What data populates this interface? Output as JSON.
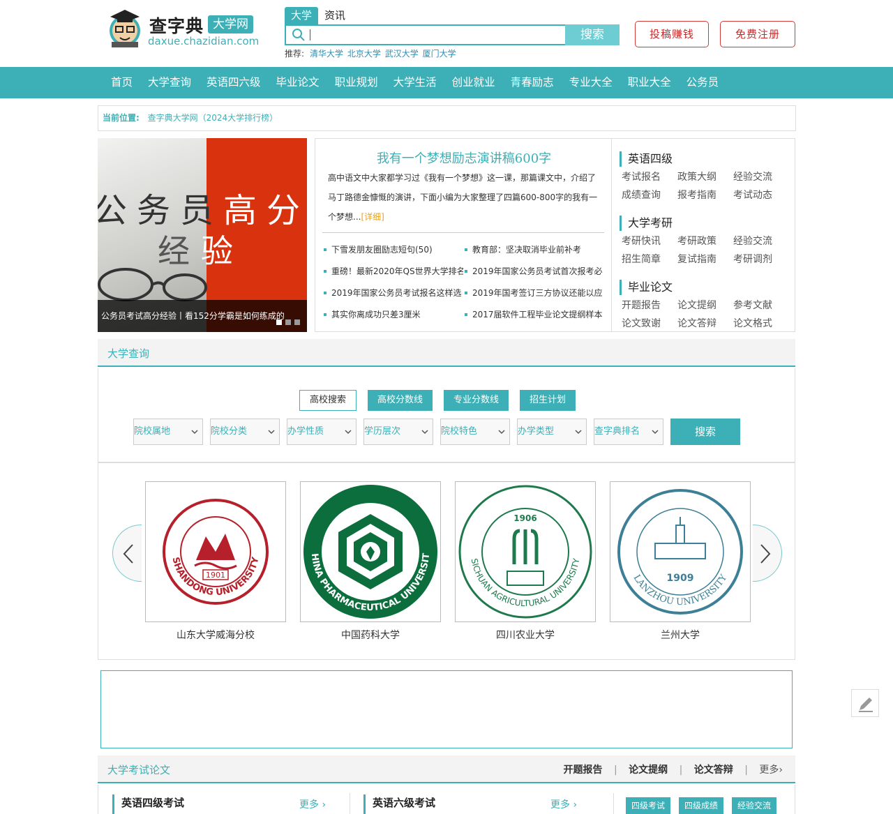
{
  "header": {
    "logo_name": "查字典",
    "logo_tag": "大学网",
    "logo_domain": "daxue.chazidian.com",
    "search_tabs": [
      "大学",
      "资讯"
    ],
    "search_placeholder": "",
    "search_button": "搜索",
    "recommend_label": "推荐:",
    "recommend_links": [
      "清华大学",
      "北京大学",
      "武汉大学",
      "厦门大学"
    ],
    "btn_submit": "投稿赚钱",
    "btn_register": "免费注册"
  },
  "nav": [
    "首页",
    "大学查询",
    "英语四六级",
    "毕业论文",
    "职业规划",
    "大学生活",
    "创业就业",
    "青春励志",
    "专业大全",
    "职业大全",
    "公务员"
  ],
  "breadcrumb": {
    "label": "当前位置:",
    "link": "查字典大学网（2024大学排行榜）"
  },
  "slider": {
    "text_line1": "公务员高分",
    "text_line2": "经验",
    "caption": "公务员考试高分经验丨看152分学霸是如何练成的",
    "active_dot": 1,
    "dot_count": 3
  },
  "feature": {
    "title": "我有一个梦想励志演讲稿600字",
    "desc": "高中语文中大家都学习过《我有一个梦想》这一课，那篇课文中，介绍了马丁路德金慷慨的演讲，下面小编为大家整理了四篇600-800字的我有一个梦想...",
    "more": "[详细]",
    "news_left": [
      "下雪发朋友圈励志短句(50)",
      "重磅！最新2020年QS世界大学排名",
      "2019年国家公务员考试报名这样选",
      "其实你离成功只差3厘米"
    ],
    "news_right": [
      "教育部：坚决取消毕业前补考",
      "2019年国家公务员考试首次报考必",
      "2019年国考签订三方协议还能以应",
      "2017届软件工程毕业论文提纲样本"
    ]
  },
  "side": [
    {
      "title": "英语四级",
      "links": [
        "考试报名",
        "政策大纲",
        "经验交流",
        "成绩查询",
        "报考指南",
        "考试动态"
      ]
    },
    {
      "title": "大学考研",
      "links": [
        "考研快讯",
        "考研政策",
        "经验交流",
        "招生简章",
        "复试指南",
        "考研调剂"
      ]
    },
    {
      "title": "毕业论文",
      "links": [
        "开题报告",
        "论文提纲",
        "参考文献",
        "论文致谢",
        "论文答辩",
        "论文格式"
      ]
    }
  ],
  "query": {
    "section_title": "大学查询",
    "tabs": [
      "高校搜索",
      "高校分数线",
      "专业分数线",
      "招生计划"
    ],
    "selects": [
      "院校属地",
      "院校分类",
      "办学性质",
      "学历层次",
      "院校特色",
      "办学类型",
      "查字典排名"
    ],
    "search_button": "搜索"
  },
  "universities": [
    {
      "name": "山东大学威海分校",
      "logo_color": "#b5202a",
      "logo_text": "SHANDONG UNIVERSITY",
      "year": "1901"
    },
    {
      "name": "中国药科大学",
      "logo_color": "#0b6e3c",
      "logo_text": "CHINA PHARMACEUTICAL UNIVERSITY",
      "year": ""
    },
    {
      "name": "四川农业大学",
      "logo_color": "#1e7a4c",
      "logo_text": "SICHUAN AGRICULTURAL UNIVERSITY",
      "year": "1906"
    },
    {
      "name": "兰州大学",
      "logo_color": "#3c7f96",
      "logo_text": "LANZHOU UNIVERSITY",
      "year": "1909"
    }
  ],
  "exam_section": {
    "title": "大学考试论文",
    "links": [
      "开题报告",
      "论文提纲",
      "论文答辩"
    ],
    "more": "更多",
    "col1_title": "英语四级考试",
    "col2_title": "英语六级考试",
    "col_more": "更多",
    "tags": [
      "四级考试",
      "四级成绩",
      "经验交流"
    ]
  },
  "colors": {
    "accent": "#3cb0b6",
    "red": "#c62b2b"
  }
}
